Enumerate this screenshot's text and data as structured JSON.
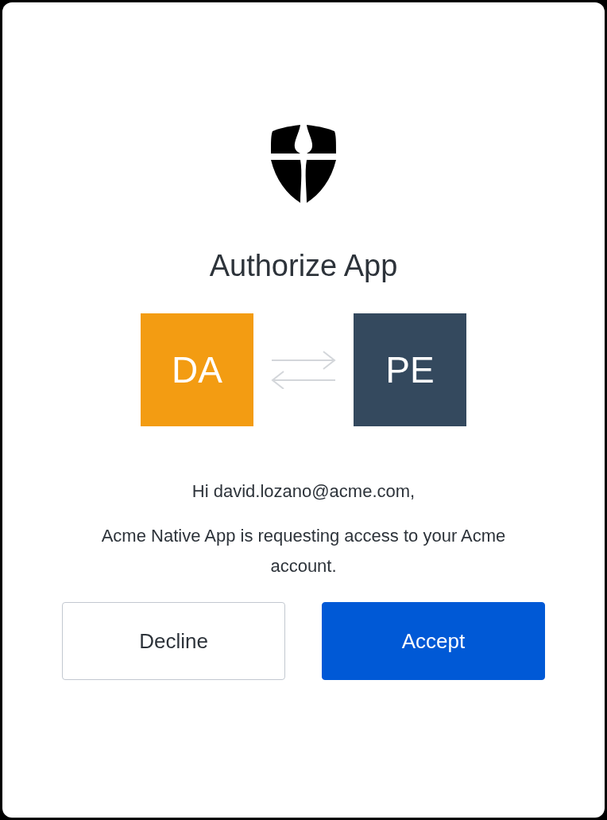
{
  "title": "Authorize App",
  "apps": [
    {
      "initials": "DA",
      "color": "#f39c12"
    },
    {
      "initials": "PE",
      "color": "#34495e"
    }
  ],
  "greeting": "Hi david.lozano@acme.com,",
  "message": "Acme Native App is requesting access to your Acme account.",
  "buttons": [
    {
      "label": "Decline",
      "kind": "secondary"
    },
    {
      "label": "Accept",
      "kind": "primary"
    }
  ]
}
